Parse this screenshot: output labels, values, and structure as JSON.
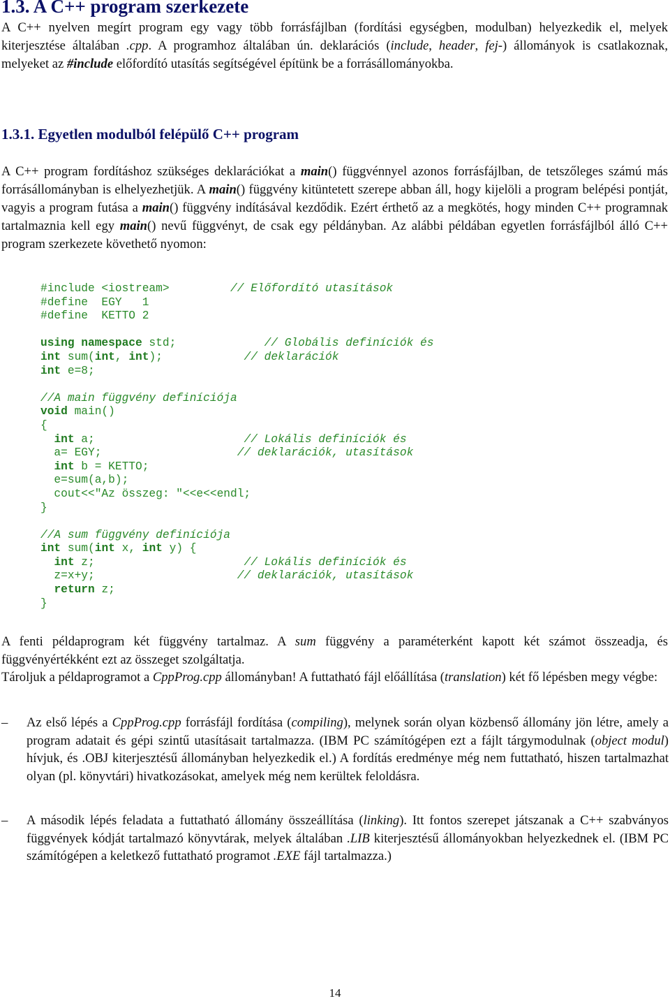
{
  "heading_main": "1.3. A C++ program szerkezete",
  "intro": {
    "t1": "A C++ nyelven megírt program egy vagy több forrásfájlban (fordítási egységben, modulban) helyezkedik el, melyek kiterjesztése általában ",
    "cpp": ".cpp",
    "t2": ". A programhoz általában ún. deklarációs (",
    "include": "include",
    "c1": ", ",
    "header": "header",
    "c2": ", ",
    "fej": "fej-",
    "t3": ") állományok is csatlakoznak, melyeket az ",
    "hash_include": "#include",
    "t4": " előfordító utasítás segítségével építünk be a forrásállományokba."
  },
  "heading_sub": "1.3.1. Egyetlen modulból felépülő C++ program",
  "para2": {
    "t1": "A C++ program fordításhoz szükséges deklarációkat a ",
    "main1": "main",
    "t2": "() függvénnyel azonos forrásfájlban, de tetszőleges számú más forrásállományban is elhelyezhetjük. A ",
    "main2": "main",
    "t3": "() függvény kitüntetett szerepe abban áll, hogy kijelöli a program belépési pontját, vagyis a program futása a ",
    "main3": "main",
    "t4": "() függvény indításával kezdődik. Ezért érthető az a megkötés, hogy minden C++ programnak tartalmaznia kell egy ",
    "main4": "main",
    "t5": "() nevű függvényt, de csak egy példányban. Az alábbi példában egyetlen forrásfájlból álló C++ program szerkezete követhető nyomon:"
  },
  "code": {
    "l1a": "#include <iostream>         ",
    "l1c": "// Előfordító utasítások",
    "l2": "#define  EGY   1",
    "l3": "#define  KETTO 2",
    "l4kw": "using namespace",
    "l4a": " std;             ",
    "l4c": "// Globális definíciók és",
    "l5kw1": "int",
    "l5a": " sum(",
    "l5kw2": "int",
    "l5b": ", ",
    "l5kw3": "int",
    "l5c": ");            ",
    "l5cm": "// deklarációk",
    "l6kw": "int",
    "l6a": " e=8;",
    "l7cm": "//A main függvény definíciója",
    "l8kw": "void",
    "l8a": " main()",
    "l9": "{",
    "l10pre": "  ",
    "l10kw": "int",
    "l10a": " a;                      ",
    "l10cm": "// Lokális definíciók és",
    "l11a": "  a= EGY;                    ",
    "l11cm": "// deklarációk, utasítások",
    "l12pre": "  ",
    "l12kw": "int",
    "l12a": " b = KETTO;",
    "l13": "  e=sum(a,b);",
    "l14": "  cout<<\"Az összeg: \"<<e<<endl;",
    "l15": "}",
    "l16cm": "//A sum függvény definíciója",
    "l17kw1": "int",
    "l17a": " sum(",
    "l17kw2": "int",
    "l17b": " x, ",
    "l17kw3": "int",
    "l17c": " y) {",
    "l18pre": "  ",
    "l18kw": "int",
    "l18a": " z;                      ",
    "l18cm": "// Lokális definíciók és",
    "l19a": "  z=x+y;                     ",
    "l19cm": "// deklarációk, utasítások",
    "l20pre": "  ",
    "l20kw": "return",
    "l20a": " z;",
    "l21": "}"
  },
  "para3": {
    "t1": "A fenti példaprogram két függvény tartalmaz. A ",
    "sum": "sum",
    "t2": " függvény a paraméterként kapott két számot összeadja, és függvényértékként ezt az összeget szolgáltatja."
  },
  "para4": {
    "t1": "Tároljuk a példaprogramot a ",
    "file": "CppProg.cpp",
    "t2": " állományban! A futtatható fájl előállítása (",
    "translation": "translation",
    "t3": ") két fő lépésben megy végbe:"
  },
  "bullets": [
    {
      "dash": "–",
      "t1": "Az első lépés a ",
      "file": "CppProg.cpp",
      "t2": " forrásfájl fordítása (",
      "i1": "compiling",
      "t3": "), melynek során olyan közbenső állomány jön létre, amely a program adatait és gépi szintű utasításait tartalmazza. (IBM PC számítógépen ezt a fájlt tárgymodulnak (",
      "i2": "object modul",
      "t4": ") hívjuk, és .OBJ kiterjesztésű állományban helyezkedik el.) A fordítás eredménye még nem futtatható, hiszen tartalmazhat olyan (pl. könyvtári) hivatkozásokat, amelyek még nem kerültek feloldásra."
    },
    {
      "dash": "–",
      "t1": "A második lépés feladata a futtatható állomány összeállítása (",
      "i1": "linking",
      "t2": "). Itt fontos szerepet játszanak a C++ szabványos függvények kódját tartalmazó könyvtárak, melyek általában ",
      "i2": ".LIB",
      "t3": " kiterjesztésű állományokban helyezkednek el. (IBM PC számítógépen a keletkező futtatható programot ",
      "i3": ".EXE",
      "t4": " fájl tartalmazza.)"
    }
  ],
  "page_number": "14",
  "colors": {
    "heading": "#0b1166",
    "code": "#2a8a2a",
    "text": "#111111"
  }
}
